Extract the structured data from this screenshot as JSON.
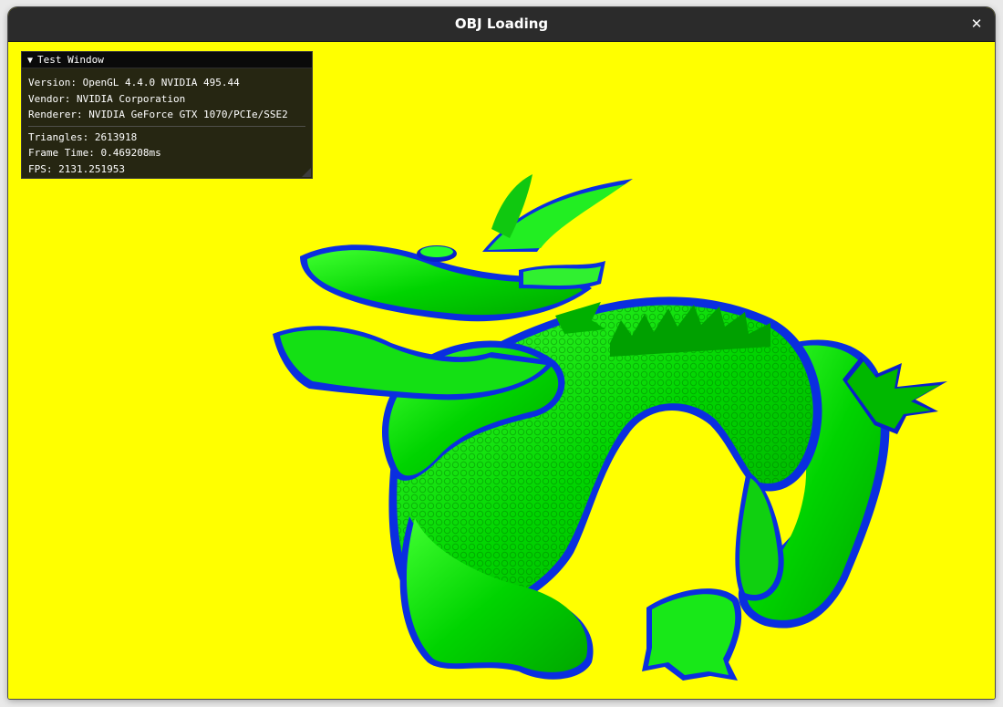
{
  "window": {
    "title": "OBJ Loading",
    "close_glyph": "✕",
    "background_color": "#ffff00"
  },
  "panel": {
    "title": "Test Window",
    "collapse_glyph": "▼",
    "info": [
      "Version: OpenGL 4.4.0 NVIDIA 495.44",
      "Vendor: NVIDIA Corporation",
      "Renderer: NVIDIA GeForce GTX 1070/PCIe/SSE2"
    ],
    "stats": [
      "Triangles: 2613918",
      "Frame Time: 0.469208ms",
      "FPS: 2131.251953"
    ]
  },
  "scene": {
    "model": "dragon-icon",
    "colors": {
      "primary": "#00e000",
      "shade": "#0018e0",
      "highlight": "#5cff3a"
    }
  }
}
